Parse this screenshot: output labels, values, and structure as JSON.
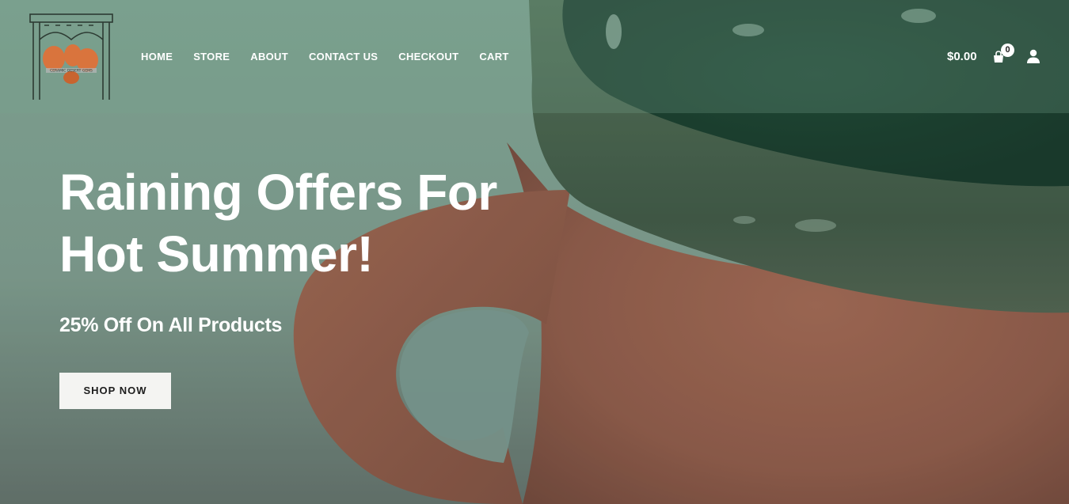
{
  "colors": {
    "overlay_green": "#6d8f80",
    "clay": "#9a5a44",
    "glaze": "#2b4a36",
    "button_bg": "#f4f4f2",
    "text_light": "#ffffff"
  },
  "header": {
    "logo_text": "CERAMIC DESERT GEMS",
    "nav": [
      "HOME",
      "STORE",
      "ABOUT",
      "CONTACT US",
      "CHECKOUT",
      "CART"
    ],
    "cart_amount": "$0.00",
    "cart_count": "0",
    "icons": {
      "cart": "shopping-bag-icon",
      "account": "user-icon"
    }
  },
  "hero": {
    "headline": "Raining Offers For Hot Summer!",
    "subhead": "25% Off On All Products",
    "cta": "SHOP NOW"
  }
}
